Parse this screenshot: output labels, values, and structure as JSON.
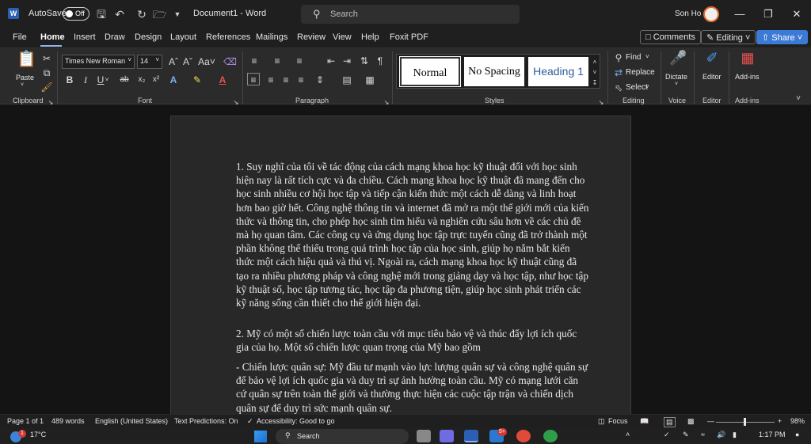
{
  "titlebar": {
    "app_logo": "W",
    "autosave_label": "AutoSave",
    "autosave_state": "Off",
    "document_title": "Document1  -  Word",
    "search_placeholder": "Search",
    "user_name": "Son Ho"
  },
  "menu": {
    "items": [
      "File",
      "Home",
      "Insert",
      "Draw",
      "Design",
      "Layout",
      "References",
      "Mailings",
      "Review",
      "View",
      "Help",
      "Foxit PDF"
    ],
    "active": "Home",
    "comments_label": "Comments",
    "editing_label": "Editing",
    "share_label": "Share"
  },
  "ribbon": {
    "paste_label": "Paste",
    "font_name": "Times New Roman",
    "font_size": "14",
    "styles": [
      "Normal",
      "No Spacing",
      "Heading 1"
    ],
    "find_label": "Find",
    "replace_label": "Replace",
    "select_label": "Select",
    "dictate_label": "Dictate",
    "editor_label": "Editor",
    "addins_label": "Add-ins",
    "group_labels": {
      "clipboard": "Clipboard",
      "font": "Font",
      "paragraph": "Paragraph",
      "styles": "Styles",
      "editing": "Editing",
      "voice": "Voice",
      "editor": "Editor",
      "addins": "Add-ins"
    }
  },
  "document": {
    "paragraphs": [
      "1. Suy nghĩ của tôi về tác động của cách mạng khoa học kỹ thuật đối với học sinh hiện nay là rất tích cực và đa chiều. Cách mạng khoa học kỹ thuật đã mang đến cho học sinh nhiều cơ hội học tập và tiếp cận kiến thức một cách dễ dàng và linh hoạt hơn bao giờ hết. Công nghệ thông tin và internet đã mở ra một thế giới mới của kiến thức và thông tin, cho phép học sinh tìm hiểu và nghiên cứu sâu hơn về các chủ đề mà họ quan tâm. Các công cụ và ứng dụng học tập trực tuyến cũng đã trở thành một phần không thể thiếu trong quá trình học tập của học sinh, giúp họ nắm bắt kiến thức một cách hiệu quả và thú vị. Ngoài ra, cách mạng khoa học kỹ thuật cũng đã tạo ra nhiều phương pháp và công nghệ mới trong giảng dạy và học tập, như học tập kỹ thuật số, học tập tương tác, học tập đa phương tiện, giúp học sinh phát triển các kỹ năng sống cần thiết cho thế giới hiện đại.",
      "2. Mỹ có một số chiến lược toàn cầu với mục tiêu bảo vệ và thúc đẩy lợi ích quốc gia của họ. Một số chiến lược quan trọng của Mỹ bao gồm",
      "- Chiến lược quân sự: Mỹ đầu tư mạnh vào lực lượng quân sự và công nghệ quân sự để bảo vệ lợi ích quốc gia và duy trì sự ảnh hưởng toàn cầu. Mỹ có mạng lưới căn cứ quân sự trên toàn thế giới và thường thực hiện các cuộc tập trận và chiến dịch quân sự để duy trì sức mạnh quân sự."
    ]
  },
  "status": {
    "page": "Page 1 of 1",
    "words": "489 words",
    "language": "English (United States)",
    "predictions": "Text Predictions: On",
    "accessibility": "Accessibility: Good to go",
    "focus": "Focus",
    "zoom": "98%"
  },
  "taskbar": {
    "temperature": "17°C",
    "search_placeholder": "Search",
    "time": "1:17 PM",
    "mail_badge": "5+"
  }
}
